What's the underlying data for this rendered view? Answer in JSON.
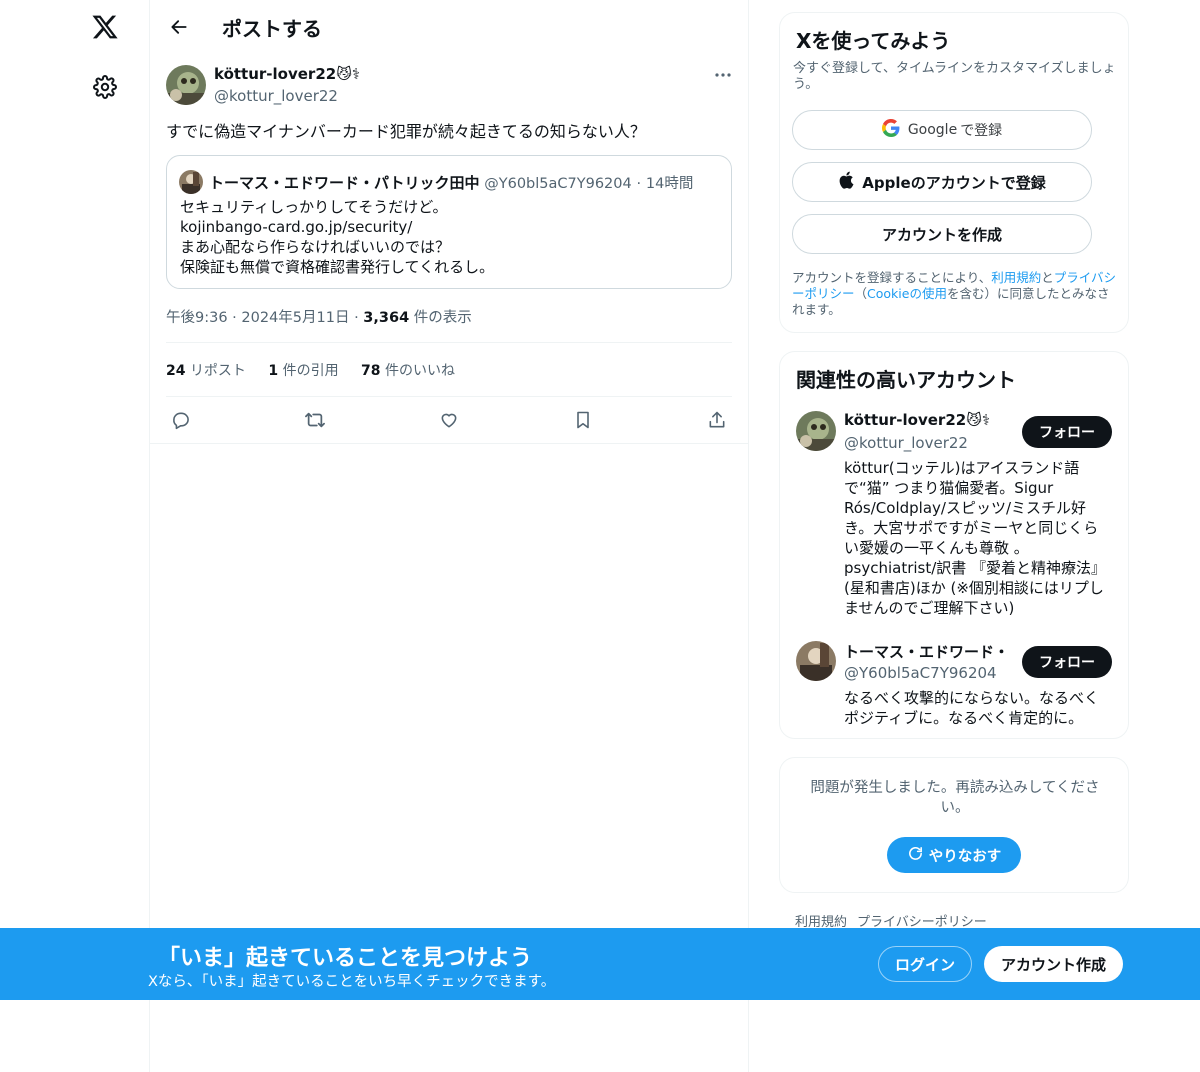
{
  "header": {
    "title": "ポストする"
  },
  "post": {
    "author_name": "köttur-lover22",
    "author_emoji": "😼⚕",
    "author_handle": "@kottur_lover22",
    "text": "すでに偽造マイナンバーカード犯罪が続々起きてるの知らない人？",
    "quote": {
      "name": "トーマス・エドワード・パトリック田中",
      "handle": "@Y60bl5aC7Y96204",
      "dot": "·",
      "time": "14時間",
      "lines": [
        "セキュリティしっかりしてそうだけど。",
        "kojinbango-card.go.jp/security/",
        "まあ心配なら作らなければいいのでは？",
        "保険証も無償で資格確認書発行してくれるし。"
      ]
    },
    "time": "午後9:36",
    "dot": "·",
    "date": "2024年5月11日",
    "views_count": "3,364",
    "views_label": "件の表示",
    "reposts_count": "24",
    "reposts_label": "リポスト",
    "quotes_count": "1",
    "quotes_label": "件の引用",
    "likes_count": "78",
    "likes_label": "件のいいね"
  },
  "signup": {
    "title": "Xを使ってみよう",
    "subtitle": "今すぐ登録して、タイムラインをカスタマイズしましょう。",
    "google_brand": "Google",
    "google_suffix": "で登録",
    "apple_label": "Appleのアカウントで登録",
    "create_label": "アカウントを作成",
    "terms_1": "アカウントを登録することにより、",
    "terms_link1": "利用規約",
    "terms_2": "と",
    "terms_link2": "プライバシーポリシー",
    "terms_3": "（",
    "terms_link3": "Cookieの使用",
    "terms_4": "を含む）に同意したとみなされます。"
  },
  "related": {
    "title": "関連性の高いアカウント",
    "accounts": [
      {
        "name": "köttur-lover22😼⚕",
        "handle": "@kottur_lover22",
        "follow": "フォロー",
        "bio": "köttur(コッテル)はアイスランド語で“猫” つまり猫偏愛者。Sigur Rós/Coldplay/スピッツ/ミスチル好き。大宮サポですがミーヤと同じくらい愛媛の一平くんも尊敬 。psychiatrist/訳書 『愛着と精神療法』(星和書店)ほか (※個別相談にはリプしませんのでご理解下さい)"
      },
      {
        "name": "トーマス・エドワード・",
        "handle": "@Y60bl5aC7Y96204",
        "follow": "フォロー",
        "bio": "なるべく攻撃的にならない。なるべくポジティブに。なるべく肯定的に。"
      }
    ]
  },
  "error_card": {
    "message": "問題が発生しました。再読み込みしてください。",
    "retry": "やりなおす"
  },
  "footer": {
    "terms": "利用規約",
    "privacy": "プライバシーポリシー"
  },
  "banner": {
    "title": "「いま」起きていることを見つけよう",
    "subtitle": "Xなら、「いま」起きていることをいち早くチェックできます。",
    "login": "ログイン",
    "signup": "アカウント作成"
  },
  "colors": {
    "accent": "#1d9bf0",
    "text": "#0f1419",
    "muted": "#536471",
    "border": "#eff3f4"
  },
  "icons": [
    "x-logo-icon",
    "gear-icon",
    "back-arrow-icon",
    "more-icon",
    "reply-icon",
    "repost-icon",
    "like-icon",
    "bookmark-icon",
    "share-icon",
    "google-icon",
    "apple-icon",
    "refresh-icon"
  ]
}
